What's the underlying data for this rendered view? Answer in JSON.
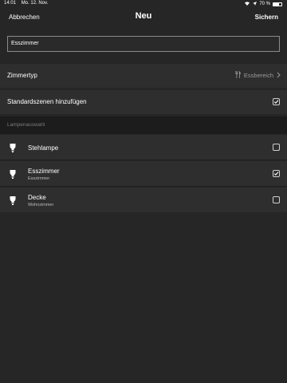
{
  "status": {
    "time": "14:01",
    "date": "Mo. 12. Nov.",
    "battery_text": "70 %",
    "battery_level": 0.7
  },
  "nav": {
    "cancel": "Abbrechen",
    "title": "Neu",
    "save": "Sichern"
  },
  "name_field": {
    "value": "Esszimmer"
  },
  "room_type": {
    "label": "Zimmertyp",
    "value": "Essbereich",
    "icon": "fork-knife-icon"
  },
  "standard_scenes": {
    "label": "Standardszenen hinzufügen",
    "checked": true
  },
  "lamp_section": {
    "header": "Lampenauswahl"
  },
  "lamps": [
    {
      "name": "Stehlampe",
      "room": "",
      "checked": false
    },
    {
      "name": "Esszimmer",
      "room": "Esszimmer",
      "checked": true
    },
    {
      "name": "Decke",
      "room": "Wohnzimmer",
      "checked": false
    }
  ]
}
